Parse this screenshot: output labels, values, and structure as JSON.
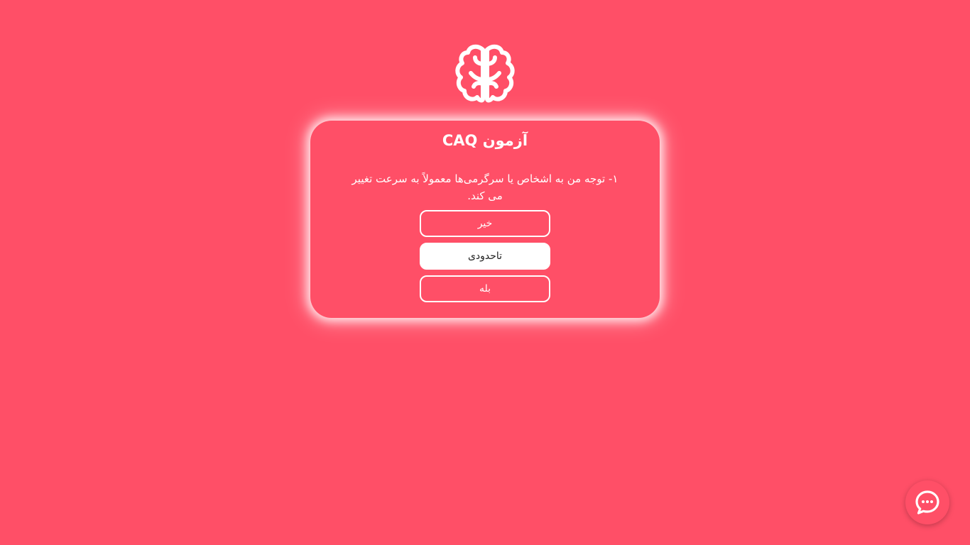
{
  "logo": {
    "icon": "brain-icon",
    "color": "#ffffff"
  },
  "card": {
    "title": "آزمون CAQ",
    "question": "۱- توجه من به اشخاص یا سرگرمی‌ها معمولاً به سرعت تغییر می کند.",
    "answers": [
      {
        "label": "خیر",
        "selected": false
      },
      {
        "label": "تاحدودی",
        "selected": true
      },
      {
        "label": "بله",
        "selected": false
      }
    ]
  },
  "chat": {
    "icon": "chat-bubble-icon"
  },
  "colors": {
    "background": "#ff4f67",
    "accent": "#ffffff"
  }
}
